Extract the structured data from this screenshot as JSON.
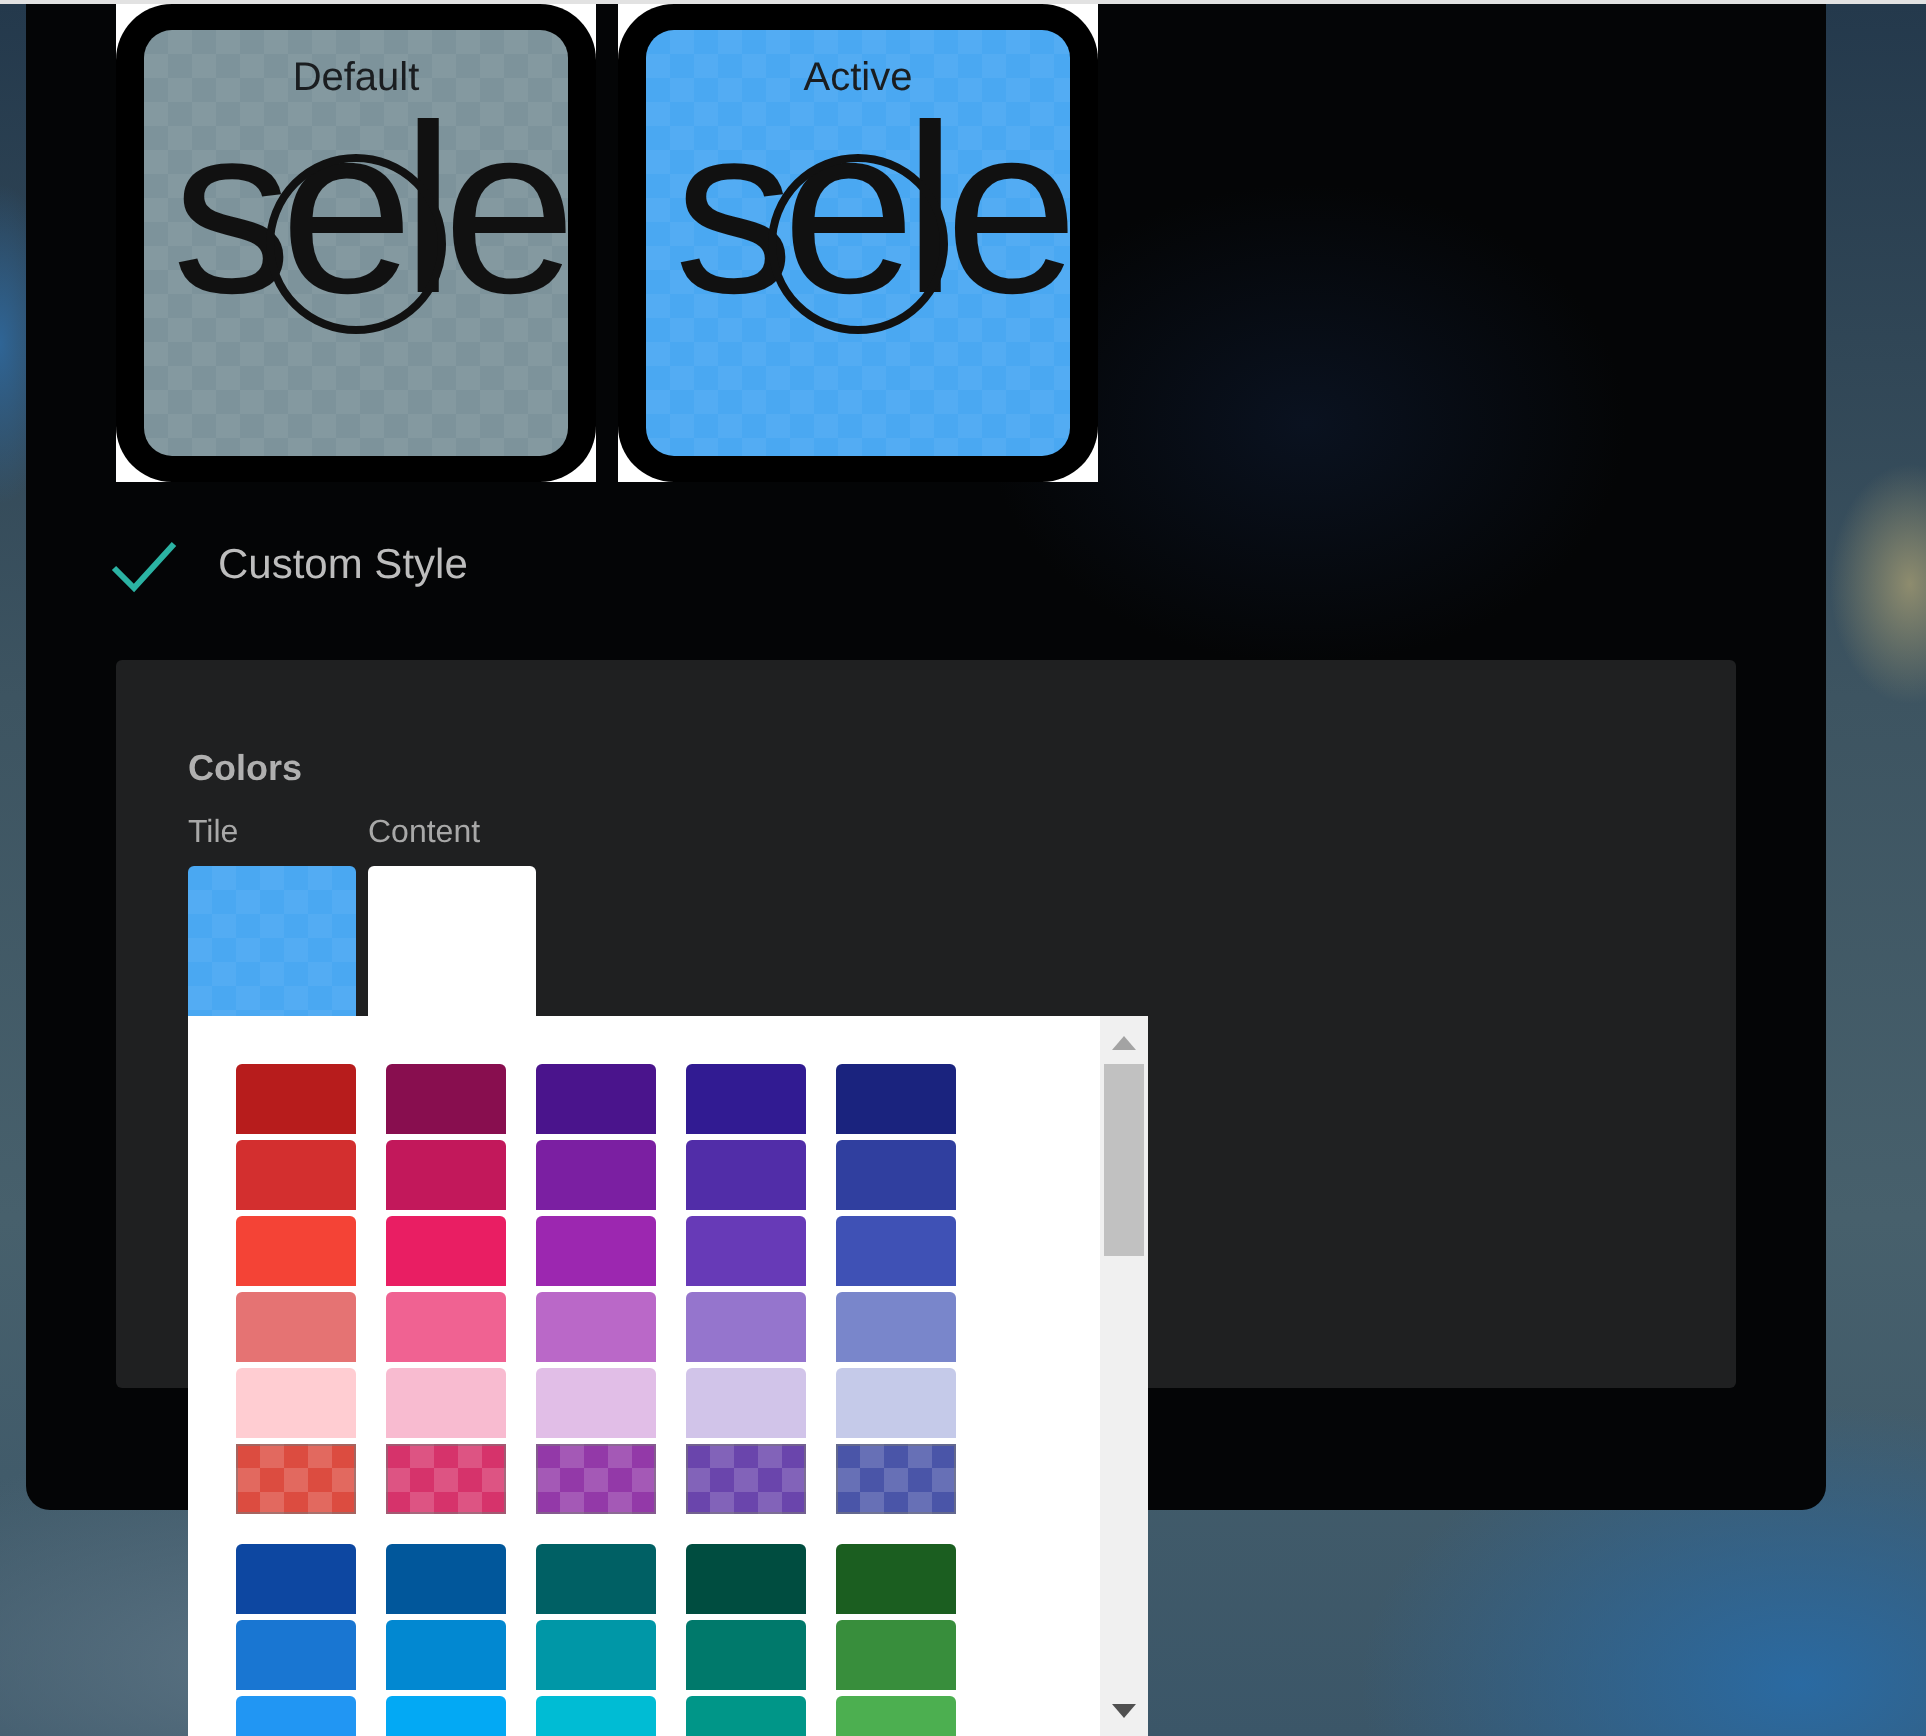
{
  "tiles": [
    {
      "label": "Default",
      "preview_text": "sele",
      "color": "#7d939b"
    },
    {
      "label": "Active",
      "preview_text": "sele",
      "color": "#4aa8f2"
    }
  ],
  "custom_style": {
    "label": "Custom Style",
    "checked": true
  },
  "colors": {
    "title": "Colors",
    "fields": [
      {
        "label": "Tile",
        "color": "#4aa8f2",
        "kind": "checkered"
      },
      {
        "label": "Content",
        "color": "#ffffff",
        "kind": "solid"
      }
    ]
  },
  "palette": {
    "groups": [
      {
        "rows": [
          {
            "swatches": [
              {
                "color": "#b71c1c",
                "kind": "solid"
              },
              {
                "color": "#880e4f",
                "kind": "solid"
              },
              {
                "color": "#4a148c",
                "kind": "solid"
              },
              {
                "color": "#311b92",
                "kind": "solid"
              },
              {
                "color": "#1a237e",
                "kind": "solid"
              }
            ]
          },
          {
            "swatches": [
              {
                "color": "#d32f2f",
                "kind": "solid"
              },
              {
                "color": "#c2185b",
                "kind": "solid"
              },
              {
                "color": "#7b1fa2",
                "kind": "solid"
              },
              {
                "color": "#512da8",
                "kind": "solid"
              },
              {
                "color": "#303f9f",
                "kind": "solid"
              }
            ]
          },
          {
            "swatches": [
              {
                "color": "#f44336",
                "kind": "solid"
              },
              {
                "color": "#e91e63",
                "kind": "solid"
              },
              {
                "color": "#9c27b0",
                "kind": "solid"
              },
              {
                "color": "#673ab7",
                "kind": "solid"
              },
              {
                "color": "#3f51b5",
                "kind": "solid"
              }
            ]
          },
          {
            "swatches": [
              {
                "color": "#e57373",
                "kind": "solid"
              },
              {
                "color": "#f06292",
                "kind": "solid"
              },
              {
                "color": "#ba68c8",
                "kind": "solid"
              },
              {
                "color": "#9575cd",
                "kind": "solid"
              },
              {
                "color": "#7986cb",
                "kind": "solid"
              }
            ]
          },
          {
            "swatches": [
              {
                "color": "#ffcdd2",
                "kind": "solid"
              },
              {
                "color": "#f8bbd0",
                "kind": "solid"
              },
              {
                "color": "#e1bee7",
                "kind": "solid"
              },
              {
                "color": "#d1c4e9",
                "kind": "solid"
              },
              {
                "color": "#c5cae9",
                "kind": "solid"
              }
            ]
          },
          {
            "swatches": [
              {
                "color": "#dc4c40",
                "kind": "checkered"
              },
              {
                "color": "#d6336b",
                "kind": "checkered"
              },
              {
                "color": "#9339a8",
                "kind": "checkered"
              },
              {
                "color": "#6a45ac",
                "kind": "checkered"
              },
              {
                "color": "#4a55a8",
                "kind": "checkered"
              }
            ]
          }
        ]
      },
      {
        "rows": [
          {
            "swatches": [
              {
                "color": "#0d47a1",
                "kind": "solid"
              },
              {
                "color": "#01579b",
                "kind": "solid"
              },
              {
                "color": "#006064",
                "kind": "solid"
              },
              {
                "color": "#004d40",
                "kind": "solid"
              },
              {
                "color": "#1b5e20",
                "kind": "solid"
              }
            ]
          },
          {
            "swatches": [
              {
                "color": "#1976d2",
                "kind": "solid"
              },
              {
                "color": "#0288d1",
                "kind": "solid"
              },
              {
                "color": "#0097a7",
                "kind": "solid"
              },
              {
                "color": "#00796b",
                "kind": "solid"
              },
              {
                "color": "#388e3c",
                "kind": "solid"
              }
            ]
          },
          {
            "swatches": [
              {
                "color": "#2196f3",
                "kind": "solid"
              },
              {
                "color": "#03a9f4",
                "kind": "solid"
              },
              {
                "color": "#00bcd4",
                "kind": "solid"
              },
              {
                "color": "#009688",
                "kind": "solid"
              },
              {
                "color": "#4caf50",
                "kind": "solid"
              }
            ]
          }
        ]
      }
    ]
  }
}
